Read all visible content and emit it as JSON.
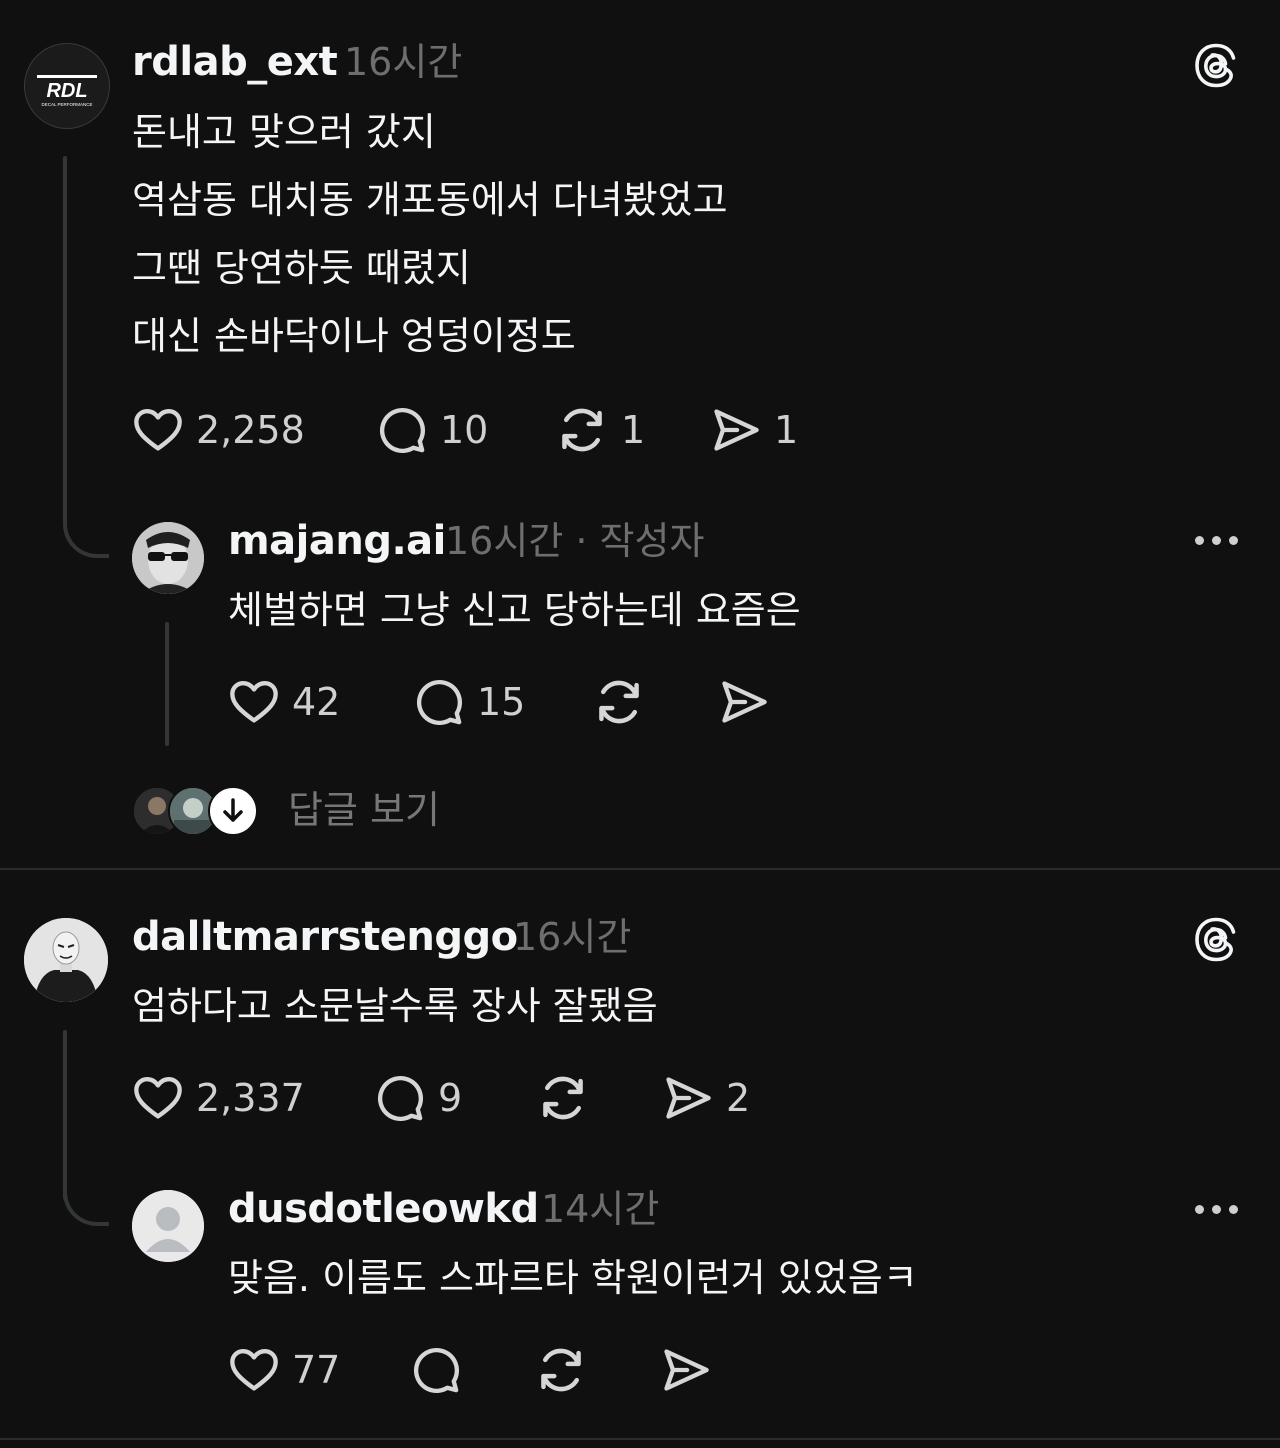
{
  "threads": [
    {
      "post": {
        "username": "rdlab_ext",
        "time": "16시간",
        "avatar_text": "RDL",
        "avatar_subtext": "DECAL PERFORMANCE",
        "lines": [
          "돈내고 맞으러 갔지",
          "역삼동 대치동 개포동에서 다녀봤었고",
          "그땐 당연하듯 때렸지",
          "대신 손바닥이나 엉덩이정도"
        ],
        "likes": "2,258",
        "comments": "10",
        "reposts": "1",
        "shares": "1"
      },
      "reply": {
        "username": "majang.ai",
        "time": "16시간",
        "author_tag": "· 작성자",
        "lines": [
          "체벌하면 그냥 신고 당하는데 요즘은"
        ],
        "likes": "42",
        "comments": "15"
      },
      "view_replies_label": "답글 보기"
    },
    {
      "post": {
        "username": "dalltmarrstenggo",
        "time": "16시간",
        "lines": [
          "엄하다고 소문날수록 장사 잘됐음"
        ],
        "likes": "2,337",
        "comments": "9",
        "shares": "2"
      },
      "reply": {
        "username": "dusdotleowkd",
        "time": "14시간",
        "lines": [
          "맞음. 이름도 스파르타 학원이런거 있었음ㅋ"
        ],
        "likes": "77"
      }
    }
  ],
  "icons": {
    "threads_logo": "threads-logo-icon",
    "like": "heart-icon",
    "comment": "comment-bubble-icon",
    "repost": "repost-icon",
    "share": "send-icon",
    "more": "more-dots-icon",
    "arrow_down": "arrow-down-icon"
  },
  "colors": {
    "background": "#101010",
    "text": "#f3f5f7",
    "muted": "#6e6e6e"
  }
}
